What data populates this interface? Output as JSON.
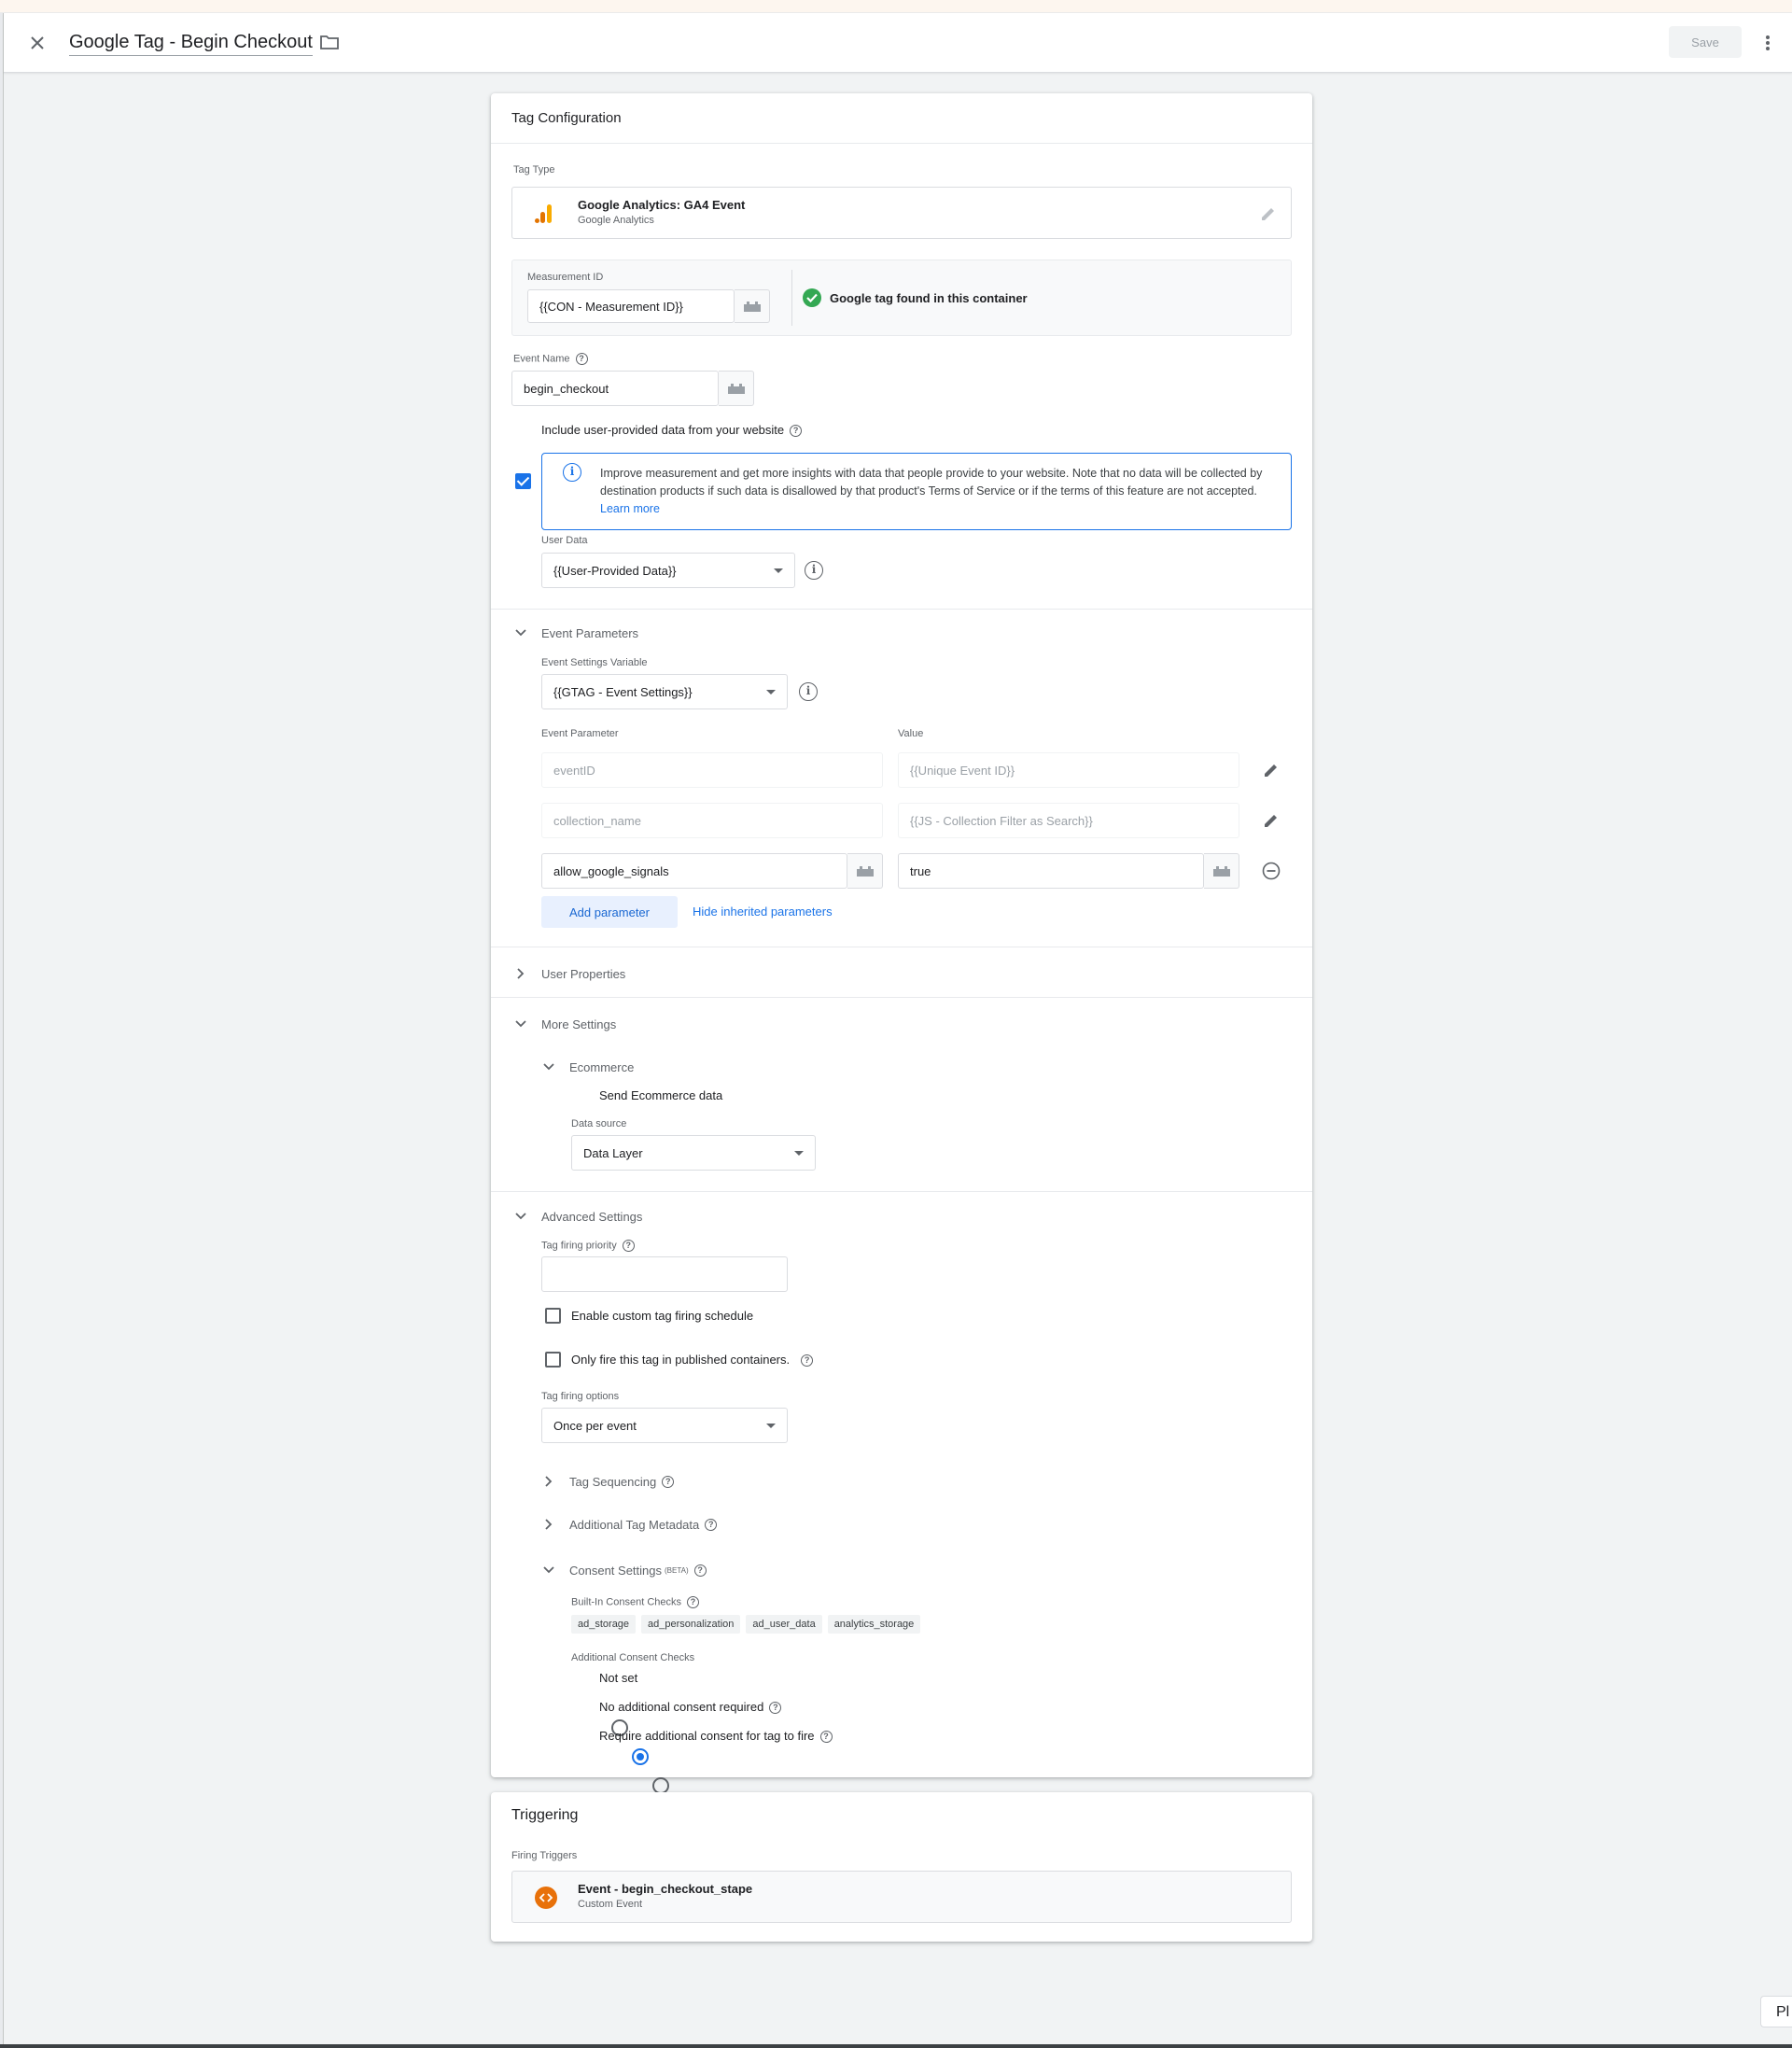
{
  "appbar": {
    "title": "Google Tag - Begin Checkout",
    "save_label": "Save"
  },
  "config": {
    "card_title": "Tag Configuration",
    "tag_type_label": "Tag Type",
    "tag_type": {
      "name": "Google Analytics: GA4 Event",
      "vendor": "Google Analytics"
    },
    "measurement_id_label": "Measurement ID",
    "measurement_id_value": "{{CON - Measurement ID}}",
    "tag_found_text": "Google tag found in this container",
    "event_name_label": "Event Name",
    "event_name_value": "begin_checkout",
    "include_user_data_label": "Include user-provided data from your website",
    "info_text": "Improve measurement and get more insights with data that people provide to your website. Note that no data will be collected by destination products if such data is disallowed by that product's Terms of Service or if the terms of this feature are not accepted.",
    "learn_more": "Learn more",
    "user_data_label": "User Data",
    "user_data_value": "{{User-Provided Data}}"
  },
  "event_params": {
    "section_title": "Event Parameters",
    "settings_var_label": "Event Settings Variable",
    "settings_var_value": "{{GTAG - Event Settings}}",
    "col_param": "Event Parameter",
    "col_value": "Value",
    "rows": [
      {
        "param": "eventID",
        "value": "{{Unique Event ID}}"
      },
      {
        "param": "collection_name",
        "value": "{{JS - Collection Filter as Search}}"
      },
      {
        "param": "allow_google_signals",
        "value": "true"
      }
    ],
    "add_param": "Add parameter",
    "hide_inherited": "Hide inherited parameters"
  },
  "user_properties": {
    "section_title": "User Properties"
  },
  "more_settings": {
    "section_title": "More Settings",
    "ecommerce_title": "Ecommerce",
    "send_ecommerce_label": "Send Ecommerce data",
    "data_source_label": "Data source",
    "data_source_value": "Data Layer"
  },
  "advanced": {
    "section_title": "Advanced Settings",
    "priority_label": "Tag firing priority",
    "priority_value": "",
    "custom_schedule_label": "Enable custom tag firing schedule",
    "published_only_label": "Only fire this tag in published containers.",
    "firing_options_label": "Tag firing options",
    "firing_options_value": "Once per event",
    "tag_sequencing": "Tag Sequencing",
    "additional_metadata": "Additional Tag Metadata",
    "consent_title": "Consent Settings",
    "consent_beta": "(BETA)",
    "builtin_checks_label": "Built-In Consent Checks",
    "builtin_checks": [
      "ad_storage",
      "ad_personalization",
      "ad_user_data",
      "analytics_storage"
    ],
    "additional_checks_label": "Additional Consent Checks",
    "consent_options": [
      "Not set",
      "No additional consent required",
      "Require additional consent for tag to fire"
    ],
    "consent_selected": 1
  },
  "triggering": {
    "card_title": "Triggering",
    "firing_label": "Firing Triggers",
    "trigger_name": "Event - begin_checkout_stape",
    "trigger_type": "Custom Event"
  },
  "corner_chip": "Pl",
  "colors": {
    "accent": "#1a73e8",
    "success": "#34a853",
    "trigger": "#e8710a",
    "analytics_dark": "#e37400",
    "analytics_light": "#f9ab00"
  }
}
